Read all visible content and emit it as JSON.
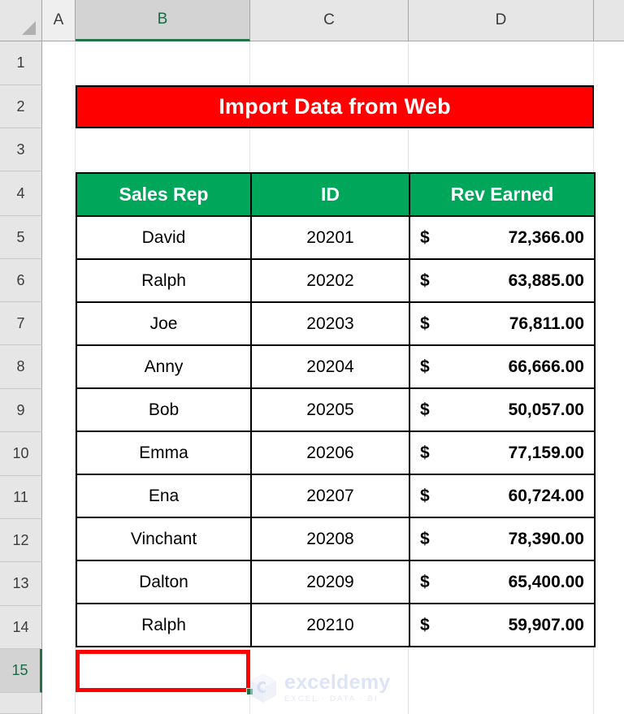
{
  "spreadsheet": {
    "column_headers": [
      "A",
      "B",
      "C",
      "D"
    ],
    "selected_column": "B",
    "row_headers": [
      "1",
      "2",
      "3",
      "4",
      "5",
      "6",
      "7",
      "8",
      "9",
      "10",
      "11",
      "12",
      "13",
      "14",
      "15"
    ],
    "selected_row": "15",
    "selected_cell": "B15",
    "select_all_icon": "select-all-triangle-icon"
  },
  "title_banner": {
    "text": "Import Data from Web",
    "background_color": "#ff0000",
    "text_color": "#ffffff",
    "border_color": "#000000"
  },
  "table": {
    "header_background": "#00a75a",
    "header_text_color": "#ffffff",
    "columns": [
      "Sales Rep",
      "ID",
      "Rev Earned"
    ],
    "currency_symbol": "$",
    "rows": [
      {
        "sales_rep": "David",
        "id": "20201",
        "rev_earned": "72,366.00"
      },
      {
        "sales_rep": "Ralph",
        "id": "20202",
        "rev_earned": "63,885.00"
      },
      {
        "sales_rep": "Joe",
        "id": "20203",
        "rev_earned": "76,811.00"
      },
      {
        "sales_rep": "Anny",
        "id": "20204",
        "rev_earned": "66,666.00"
      },
      {
        "sales_rep": "Bob",
        "id": "20205",
        "rev_earned": "50,057.00"
      },
      {
        "sales_rep": "Emma",
        "id": "20206",
        "rev_earned": "77,159.00"
      },
      {
        "sales_rep": "Ena",
        "id": "20207",
        "rev_earned": "60,724.00"
      },
      {
        "sales_rep": "Vinchant",
        "id": "20208",
        "rev_earned": "78,390.00"
      },
      {
        "sales_rep": "Dalton",
        "id": "20209",
        "rev_earned": "65,400.00"
      },
      {
        "sales_rep": "Ralph",
        "id": "20210",
        "rev_earned": "59,907.00"
      }
    ]
  },
  "selection": {
    "highlight_color": "#ff0000",
    "fill_handle_color": "#217346",
    "value": ""
  },
  "watermark": {
    "name": "exceldemy",
    "tagline": "EXCEL  ·  DATA  ·  BI",
    "logo_icon": "cube-logo-icon",
    "color": "#c3cef0"
  }
}
